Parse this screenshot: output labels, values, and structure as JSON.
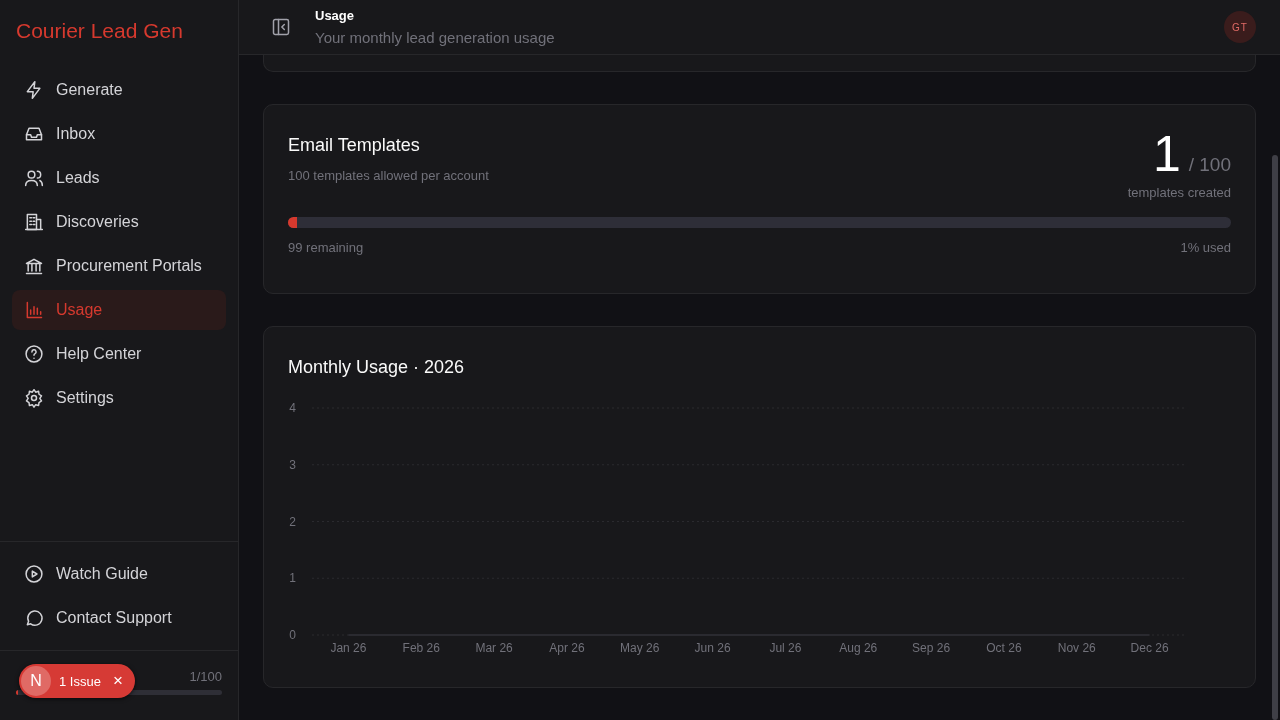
{
  "sidebar": {
    "brand": "Courier Lead Gen",
    "items": [
      {
        "label": "Generate",
        "selected": false
      },
      {
        "label": "Inbox",
        "selected": false
      },
      {
        "label": "Leads",
        "selected": false
      },
      {
        "label": "Discoveries",
        "selected": false
      },
      {
        "label": "Procurement Portals",
        "selected": false
      },
      {
        "label": "Usage",
        "selected": true
      },
      {
        "label": "Help Center",
        "selected": false
      },
      {
        "label": "Settings",
        "selected": false
      }
    ],
    "footer_items": [
      {
        "label": "Watch Guide"
      },
      {
        "label": "Contact Support"
      }
    ],
    "quota": {
      "reading": "1/100",
      "level": 0.01
    },
    "issue_badge": {
      "logo": "N",
      "label": "1 Issue",
      "close": "×"
    }
  },
  "header": {
    "title": "Usage",
    "subtitle": "Your monthly lead generation usage",
    "avatar": "GT"
  },
  "templates_card": {
    "title": "Email Templates",
    "subtitle": "100 templates allowed per account",
    "count": "1",
    "limit": "/ 100",
    "count_caption": "templates created",
    "level": 0.01,
    "remaining": "99 remaining",
    "used": "1% used"
  },
  "monthly_card": {
    "title": "Monthly Usage · 2026",
    "chart_data": {
      "type": "line",
      "categories": [
        "Jan 26",
        "Feb 26",
        "Mar 26",
        "Apr 26",
        "May 26",
        "Jun 26",
        "Jul 26",
        "Aug 26",
        "Sep 26",
        "Oct 26",
        "Nov 26",
        "Dec 26"
      ],
      "ylim": [
        0,
        4
      ],
      "yticks": [
        0,
        1,
        2,
        3,
        4
      ],
      "series": [
        {
          "color": "#2a2a30",
          "values": [
            0,
            0,
            0,
            0,
            0,
            0,
            0,
            0,
            0,
            0,
            0,
            0
          ]
        }
      ]
    }
  }
}
